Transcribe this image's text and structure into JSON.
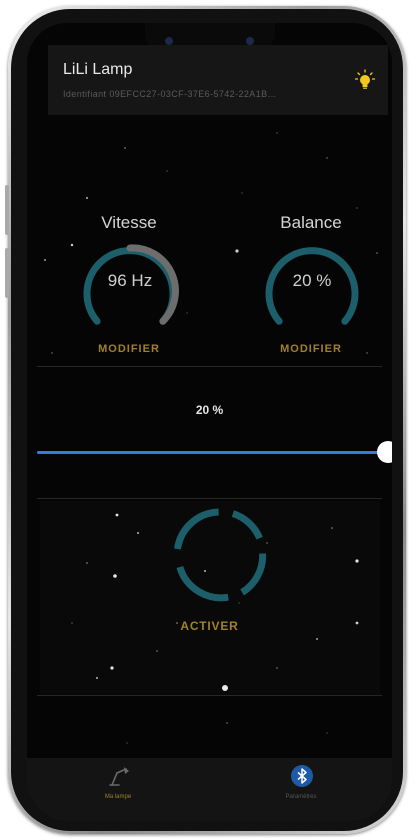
{
  "app": {
    "title": "LiLi Lamp",
    "identifier": "Identifiant 09EFCC27-03CF-37E6-5742-22A1B…"
  },
  "gauges": [
    {
      "label": "Vitesse",
      "value_text": "96 Hz",
      "action": "MODIFIER",
      "fraction": 0.55
    },
    {
      "label": "Balance",
      "value_text": "20 %",
      "action": "MODIFIER",
      "fraction": 1.0
    }
  ],
  "slider": {
    "value_text": "20 %",
    "value_fraction": 1.0
  },
  "activate": {
    "label": "ACTIVER"
  },
  "tabs": [
    {
      "label": "Ma lampe",
      "icon": "lamp-icon",
      "active": true
    },
    {
      "label": "Paramètres",
      "icon": "bluetooth-icon",
      "active": false
    }
  ],
  "colors": {
    "accent_gold": "#a0812a",
    "gauge_teal": "#1c5f6a",
    "gauge_grey": "#6d6d6d",
    "slider_blue": "#2f7ee0",
    "bulb_yellow": "#f2c81c"
  }
}
